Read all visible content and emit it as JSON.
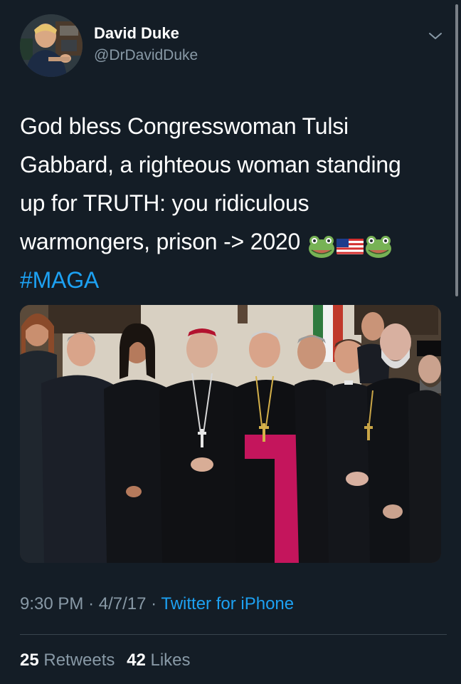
{
  "author": {
    "display_name": "David Duke",
    "handle": "@DrDavidDuke"
  },
  "tweet": {
    "lines": [
      "God bless Congresswoman Tulsi",
      "Gabbard, a righteous woman standing",
      "up for TRUTH: you ridiculous",
      "warmongers, prison -> 2020"
    ],
    "emojis": [
      "frog-emoji",
      "us-flag-emoji",
      "frog-emoji"
    ],
    "hashtag": "#MAGA"
  },
  "meta": {
    "time": "9:30 PM",
    "separator": "·",
    "date": "4/7/17",
    "source": "Twitter for iPhone"
  },
  "stats": {
    "retweets_count": "25",
    "retweets_label": "Retweets",
    "likes_count": "42",
    "likes_label": "Likes"
  },
  "colors": {
    "background": "#141d26",
    "text": "#ffffff",
    "secondary_text": "#8899a6",
    "link": "#1da1f2",
    "divider": "#38444d"
  },
  "icons": {
    "menu": "chevron-down-icon"
  }
}
